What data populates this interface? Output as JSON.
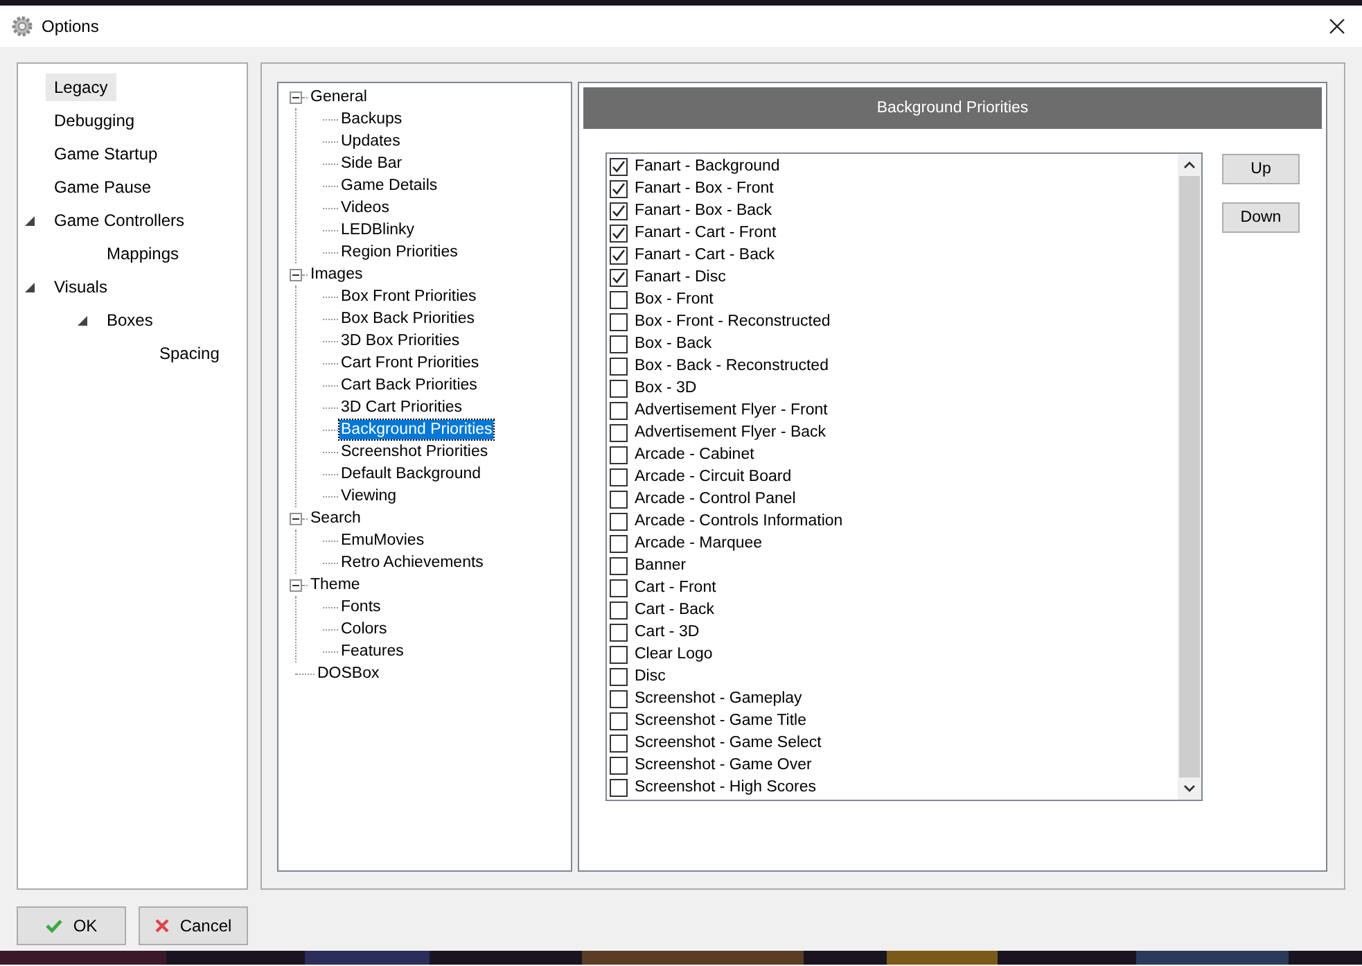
{
  "window": {
    "title": "Options"
  },
  "nav": [
    {
      "label": "Legacy",
      "selected": true
    },
    {
      "label": "Debugging",
      "selected": false
    },
    {
      "label": "Game Startup",
      "selected": false
    },
    {
      "label": "Game Pause",
      "selected": false
    },
    {
      "label": "Game Controllers",
      "selected": false,
      "expanded": true,
      "children": [
        {
          "label": "Mappings",
          "selected": false
        }
      ]
    },
    {
      "label": "Visuals",
      "selected": false,
      "expanded": true,
      "children": [
        {
          "label": "Boxes",
          "selected": false,
          "expanded": true,
          "children": [
            {
              "label": "Spacing",
              "selected": false
            }
          ]
        }
      ]
    }
  ],
  "tree": [
    {
      "label": "General",
      "selected": false,
      "expanded": true,
      "children": [
        {
          "label": "Backups",
          "selected": false
        },
        {
          "label": "Updates",
          "selected": false
        },
        {
          "label": "Side Bar",
          "selected": false
        },
        {
          "label": "Game Details",
          "selected": false
        },
        {
          "label": "Videos",
          "selected": false
        },
        {
          "label": "LEDBlinky",
          "selected": false
        },
        {
          "label": "Region Priorities",
          "selected": false
        }
      ]
    },
    {
      "label": "Images",
      "selected": false,
      "expanded": true,
      "children": [
        {
          "label": "Box Front Priorities",
          "selected": false
        },
        {
          "label": "Box Back Priorities",
          "selected": false
        },
        {
          "label": "3D Box Priorities",
          "selected": false
        },
        {
          "label": "Cart Front Priorities",
          "selected": false
        },
        {
          "label": "Cart Back Priorities",
          "selected": false
        },
        {
          "label": "3D Cart Priorities",
          "selected": false
        },
        {
          "label": "Background Priorities",
          "selected": true
        },
        {
          "label": "Screenshot Priorities",
          "selected": false
        },
        {
          "label": "Default Background",
          "selected": false
        },
        {
          "label": "Viewing",
          "selected": false
        }
      ]
    },
    {
      "label": "Search",
      "selected": false,
      "expanded": true,
      "children": [
        {
          "label": "EmuMovies",
          "selected": false
        },
        {
          "label": "Retro Achievements",
          "selected": false
        }
      ]
    },
    {
      "label": "Theme",
      "selected": false,
      "expanded": true,
      "children": [
        {
          "label": "Fonts",
          "selected": false
        },
        {
          "label": "Colors",
          "selected": false
        },
        {
          "label": "Features",
          "selected": false
        }
      ]
    },
    {
      "label": "DOSBox",
      "selected": false
    }
  ],
  "panel": {
    "title": "Background Priorities"
  },
  "priorities": [
    {
      "label": "Fanart - Background",
      "checked": true
    },
    {
      "label": "Fanart - Box - Front",
      "checked": true
    },
    {
      "label": "Fanart - Box - Back",
      "checked": true
    },
    {
      "label": "Fanart - Cart - Front",
      "checked": true
    },
    {
      "label": "Fanart - Cart - Back",
      "checked": true
    },
    {
      "label": "Fanart - Disc",
      "checked": true
    },
    {
      "label": "Box - Front",
      "checked": false
    },
    {
      "label": "Box - Front - Reconstructed",
      "checked": false
    },
    {
      "label": "Box - Back",
      "checked": false
    },
    {
      "label": "Box - Back - Reconstructed",
      "checked": false
    },
    {
      "label": "Box - 3D",
      "checked": false
    },
    {
      "label": "Advertisement Flyer - Front",
      "checked": false
    },
    {
      "label": "Advertisement Flyer - Back",
      "checked": false
    },
    {
      "label": "Arcade - Cabinet",
      "checked": false
    },
    {
      "label": "Arcade - Circuit Board",
      "checked": false
    },
    {
      "label": "Arcade - Control Panel",
      "checked": false
    },
    {
      "label": "Arcade - Controls Information",
      "checked": false
    },
    {
      "label": "Arcade - Marquee",
      "checked": false
    },
    {
      "label": "Banner",
      "checked": false
    },
    {
      "label": "Cart - Front",
      "checked": false
    },
    {
      "label": "Cart - Back",
      "checked": false
    },
    {
      "label": "Cart - 3D",
      "checked": false
    },
    {
      "label": "Clear Logo",
      "checked": false
    },
    {
      "label": "Disc",
      "checked": false
    },
    {
      "label": "Screenshot - Gameplay",
      "checked": false
    },
    {
      "label": "Screenshot - Game Title",
      "checked": false
    },
    {
      "label": "Screenshot - Game Select",
      "checked": false
    },
    {
      "label": "Screenshot - Game Over",
      "checked": false
    },
    {
      "label": "Screenshot - High Scores",
      "checked": false
    }
  ],
  "side_buttons": [
    "Up",
    "Down"
  ],
  "buttons": [
    {
      "label": "OK",
      "kind": "ok"
    },
    {
      "label": "Cancel",
      "kind": "cancel"
    }
  ]
}
